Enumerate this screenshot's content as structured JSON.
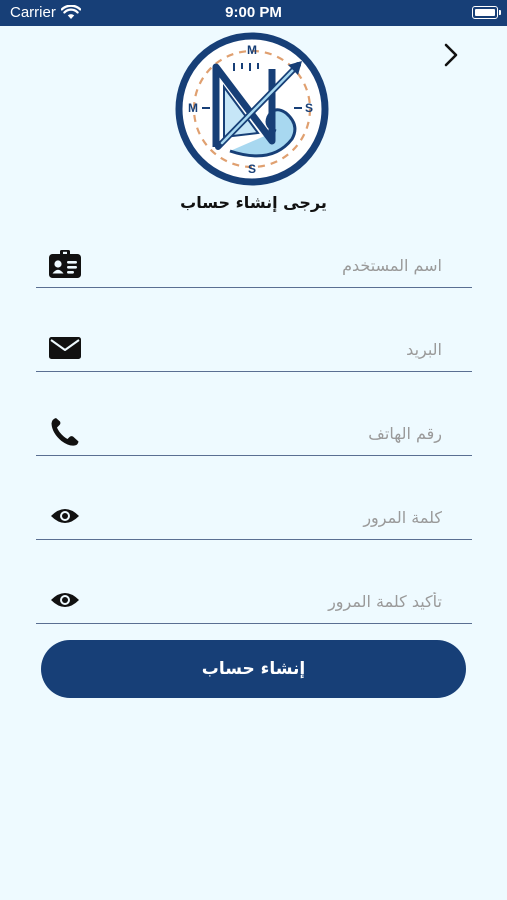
{
  "status_bar": {
    "carrier": "Carrier",
    "time": "9:00 PM"
  },
  "logo": {
    "letters": [
      "M",
      "M",
      "S",
      "S"
    ]
  },
  "header": {
    "subtitle": "يرجى إنشاء حساب"
  },
  "form": {
    "username": {
      "placeholder": "اسم المستخدم",
      "value": ""
    },
    "email": {
      "placeholder": "البريد",
      "value": ""
    },
    "phone": {
      "placeholder": "رقم الهاتف",
      "value": ""
    },
    "password": {
      "placeholder": "كلمة المرور",
      "value": ""
    },
    "confirm_password": {
      "placeholder": "تأكيد كلمة المرور",
      "value": ""
    }
  },
  "submit": {
    "label": "إنشاء حساب"
  },
  "colors": {
    "primary": "#173f77",
    "background": "#eefaff",
    "accent_orange": "#e0a070",
    "accent_light_blue": "#a8d8f0"
  }
}
